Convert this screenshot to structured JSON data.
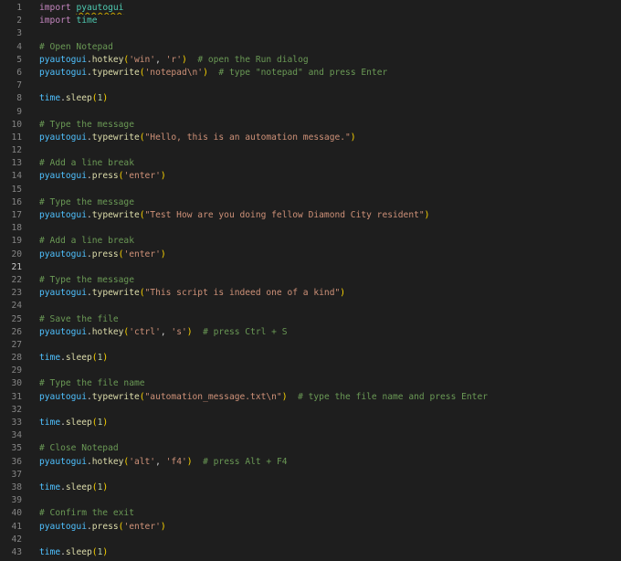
{
  "editor": {
    "active_line": 21,
    "colors": {
      "background": "#1e1e1e",
      "keyword": "#c586c0",
      "module": "#4ec9b0",
      "variable": "#4fc1ff",
      "function": "#dcdcaa",
      "string": "#ce9178",
      "number": "#b5cea8",
      "comment": "#6a9955",
      "bracket": "#ffd700",
      "line_number": "#858585"
    },
    "lines": [
      {
        "n": "1",
        "tokens": [
          {
            "t": "import ",
            "c": "kw"
          },
          {
            "t": "pyautogui",
            "c": "mod sq"
          }
        ]
      },
      {
        "n": "2",
        "tokens": [
          {
            "t": "import ",
            "c": "kw"
          },
          {
            "t": "time",
            "c": "mod"
          }
        ]
      },
      {
        "n": "3",
        "tokens": []
      },
      {
        "n": "4",
        "tokens": [
          {
            "t": "# Open Notepad",
            "c": "cm"
          }
        ]
      },
      {
        "n": "5",
        "tokens": [
          {
            "t": "pyautogui",
            "c": "var"
          },
          {
            "t": ".",
            "c": "plain"
          },
          {
            "t": "hotkey",
            "c": "fn"
          },
          {
            "t": "(",
            "c": "p"
          },
          {
            "t": "'win'",
            "c": "str"
          },
          {
            "t": ", ",
            "c": "plain"
          },
          {
            "t": "'r'",
            "c": "str"
          },
          {
            "t": ")",
            "c": "p"
          },
          {
            "t": "  ",
            "c": "plain"
          },
          {
            "t": "# open the Run dialog",
            "c": "cm"
          }
        ]
      },
      {
        "n": "6",
        "tokens": [
          {
            "t": "pyautogui",
            "c": "var"
          },
          {
            "t": ".",
            "c": "plain"
          },
          {
            "t": "typewrite",
            "c": "fn"
          },
          {
            "t": "(",
            "c": "p"
          },
          {
            "t": "'notepad\\n'",
            "c": "str"
          },
          {
            "t": ")",
            "c": "p"
          },
          {
            "t": "  ",
            "c": "plain"
          },
          {
            "t": "# type \"notepad\" and press Enter",
            "c": "cm"
          }
        ]
      },
      {
        "n": "7",
        "tokens": []
      },
      {
        "n": "8",
        "tokens": [
          {
            "t": "time",
            "c": "var"
          },
          {
            "t": ".",
            "c": "plain"
          },
          {
            "t": "sleep",
            "c": "fn"
          },
          {
            "t": "(",
            "c": "p"
          },
          {
            "t": "1",
            "c": "num"
          },
          {
            "t": ")",
            "c": "p"
          }
        ]
      },
      {
        "n": "9",
        "tokens": []
      },
      {
        "n": "10",
        "tokens": [
          {
            "t": "# Type the message",
            "c": "cm"
          }
        ]
      },
      {
        "n": "11",
        "tokens": [
          {
            "t": "pyautogui",
            "c": "var"
          },
          {
            "t": ".",
            "c": "plain"
          },
          {
            "t": "typewrite",
            "c": "fn"
          },
          {
            "t": "(",
            "c": "p"
          },
          {
            "t": "\"Hello, this is an automation message.\"",
            "c": "str"
          },
          {
            "t": ")",
            "c": "p"
          }
        ]
      },
      {
        "n": "12",
        "tokens": []
      },
      {
        "n": "13",
        "tokens": [
          {
            "t": "# Add a line break",
            "c": "cm"
          }
        ]
      },
      {
        "n": "14",
        "tokens": [
          {
            "t": "pyautogui",
            "c": "var"
          },
          {
            "t": ".",
            "c": "plain"
          },
          {
            "t": "press",
            "c": "fn"
          },
          {
            "t": "(",
            "c": "p"
          },
          {
            "t": "'enter'",
            "c": "str"
          },
          {
            "t": ")",
            "c": "p"
          }
        ]
      },
      {
        "n": "15",
        "tokens": []
      },
      {
        "n": "16",
        "tokens": [
          {
            "t": "# Type the message",
            "c": "cm"
          }
        ]
      },
      {
        "n": "17",
        "tokens": [
          {
            "t": "pyautogui",
            "c": "var"
          },
          {
            "t": ".",
            "c": "plain"
          },
          {
            "t": "typewrite",
            "c": "fn"
          },
          {
            "t": "(",
            "c": "p"
          },
          {
            "t": "\"Test How are you doing fellow Diamond City resident\"",
            "c": "str"
          },
          {
            "t": ")",
            "c": "p"
          }
        ]
      },
      {
        "n": "18",
        "tokens": []
      },
      {
        "n": "19",
        "tokens": [
          {
            "t": "# Add a line break",
            "c": "cm"
          }
        ]
      },
      {
        "n": "20",
        "tokens": [
          {
            "t": "pyautogui",
            "c": "var"
          },
          {
            "t": ".",
            "c": "plain"
          },
          {
            "t": "press",
            "c": "fn"
          },
          {
            "t": "(",
            "c": "p"
          },
          {
            "t": "'enter'",
            "c": "str"
          },
          {
            "t": ")",
            "c": "p"
          }
        ]
      },
      {
        "n": "21",
        "tokens": []
      },
      {
        "n": "22",
        "tokens": [
          {
            "t": "# Type the message",
            "c": "cm"
          }
        ]
      },
      {
        "n": "23",
        "tokens": [
          {
            "t": "pyautogui",
            "c": "var"
          },
          {
            "t": ".",
            "c": "plain"
          },
          {
            "t": "typewrite",
            "c": "fn"
          },
          {
            "t": "(",
            "c": "p"
          },
          {
            "t": "\"This script is indeed one of a kind\"",
            "c": "str"
          },
          {
            "t": ")",
            "c": "p"
          }
        ]
      },
      {
        "n": "24",
        "tokens": []
      },
      {
        "n": "25",
        "tokens": [
          {
            "t": "# Save the file",
            "c": "cm"
          }
        ]
      },
      {
        "n": "26",
        "tokens": [
          {
            "t": "pyautogui",
            "c": "var"
          },
          {
            "t": ".",
            "c": "plain"
          },
          {
            "t": "hotkey",
            "c": "fn"
          },
          {
            "t": "(",
            "c": "p"
          },
          {
            "t": "'ctrl'",
            "c": "str"
          },
          {
            "t": ", ",
            "c": "plain"
          },
          {
            "t": "'s'",
            "c": "str"
          },
          {
            "t": ")",
            "c": "p"
          },
          {
            "t": "  ",
            "c": "plain"
          },
          {
            "t": "# press Ctrl + S",
            "c": "cm"
          }
        ]
      },
      {
        "n": "27",
        "tokens": []
      },
      {
        "n": "28",
        "tokens": [
          {
            "t": "time",
            "c": "var"
          },
          {
            "t": ".",
            "c": "plain"
          },
          {
            "t": "sleep",
            "c": "fn"
          },
          {
            "t": "(",
            "c": "p"
          },
          {
            "t": "1",
            "c": "num"
          },
          {
            "t": ")",
            "c": "p"
          }
        ]
      },
      {
        "n": "29",
        "tokens": []
      },
      {
        "n": "30",
        "tokens": [
          {
            "t": "# Type the file name",
            "c": "cm"
          }
        ]
      },
      {
        "n": "31",
        "tokens": [
          {
            "t": "pyautogui",
            "c": "var"
          },
          {
            "t": ".",
            "c": "plain"
          },
          {
            "t": "typewrite",
            "c": "fn"
          },
          {
            "t": "(",
            "c": "p"
          },
          {
            "t": "\"automation_message.txt\\n\"",
            "c": "str"
          },
          {
            "t": ")",
            "c": "p"
          },
          {
            "t": "  ",
            "c": "plain"
          },
          {
            "t": "# type the file name and press Enter",
            "c": "cm"
          }
        ]
      },
      {
        "n": "32",
        "tokens": []
      },
      {
        "n": "33",
        "tokens": [
          {
            "t": "time",
            "c": "var"
          },
          {
            "t": ".",
            "c": "plain"
          },
          {
            "t": "sleep",
            "c": "fn"
          },
          {
            "t": "(",
            "c": "p"
          },
          {
            "t": "1",
            "c": "num"
          },
          {
            "t": ")",
            "c": "p"
          }
        ]
      },
      {
        "n": "34",
        "tokens": []
      },
      {
        "n": "35",
        "tokens": [
          {
            "t": "# Close Notepad",
            "c": "cm"
          }
        ]
      },
      {
        "n": "36",
        "tokens": [
          {
            "t": "pyautogui",
            "c": "var"
          },
          {
            "t": ".",
            "c": "plain"
          },
          {
            "t": "hotkey",
            "c": "fn"
          },
          {
            "t": "(",
            "c": "p"
          },
          {
            "t": "'alt'",
            "c": "str"
          },
          {
            "t": ", ",
            "c": "plain"
          },
          {
            "t": "'f4'",
            "c": "str"
          },
          {
            "t": ")",
            "c": "p"
          },
          {
            "t": "  ",
            "c": "plain"
          },
          {
            "t": "# press Alt + F4",
            "c": "cm"
          }
        ]
      },
      {
        "n": "37",
        "tokens": []
      },
      {
        "n": "38",
        "tokens": [
          {
            "t": "time",
            "c": "var"
          },
          {
            "t": ".",
            "c": "plain"
          },
          {
            "t": "sleep",
            "c": "fn"
          },
          {
            "t": "(",
            "c": "p"
          },
          {
            "t": "1",
            "c": "num"
          },
          {
            "t": ")",
            "c": "p"
          }
        ]
      },
      {
        "n": "39",
        "tokens": []
      },
      {
        "n": "40",
        "tokens": [
          {
            "t": "# Confirm the exit",
            "c": "cm"
          }
        ]
      },
      {
        "n": "41",
        "tokens": [
          {
            "t": "pyautogui",
            "c": "var"
          },
          {
            "t": ".",
            "c": "plain"
          },
          {
            "t": "press",
            "c": "fn"
          },
          {
            "t": "(",
            "c": "p"
          },
          {
            "t": "'enter'",
            "c": "str"
          },
          {
            "t": ")",
            "c": "p"
          }
        ]
      },
      {
        "n": "42",
        "tokens": []
      },
      {
        "n": "43",
        "tokens": [
          {
            "t": "time",
            "c": "var"
          },
          {
            "t": ".",
            "c": "plain"
          },
          {
            "t": "sleep",
            "c": "fn"
          },
          {
            "t": "(",
            "c": "p"
          },
          {
            "t": "1",
            "c": "num"
          },
          {
            "t": ")",
            "c": "p"
          }
        ]
      }
    ]
  }
}
